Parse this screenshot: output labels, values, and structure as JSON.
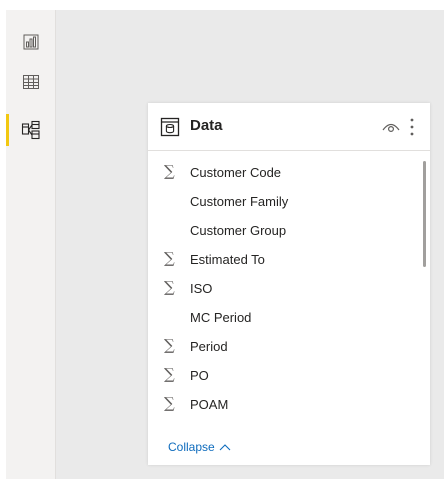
{
  "left_rail": {
    "items": [
      {
        "name": "report-view",
        "icon": "bar-chart-icon",
        "active": false
      },
      {
        "name": "table-view",
        "icon": "table-grid-icon",
        "active": false
      },
      {
        "name": "model-view",
        "icon": "model-diagram-icon",
        "active": true
      }
    ],
    "active_accent": "#f2c811"
  },
  "panel": {
    "title": "Data",
    "icons": [
      "database-icon",
      "eye-icon",
      "more-options-icon"
    ],
    "fields": [
      {
        "label": "Customer Code",
        "summarized": true,
        "symbol": "∑"
      },
      {
        "label": "Customer Family",
        "summarized": false,
        "symbol": ""
      },
      {
        "label": "Customer Group",
        "summarized": false,
        "symbol": ""
      },
      {
        "label": "Estimated To",
        "summarized": true,
        "symbol": "∑"
      },
      {
        "label": "ISO",
        "summarized": true,
        "symbol": "∑"
      },
      {
        "label": "MC Period",
        "summarized": false,
        "symbol": ""
      },
      {
        "label": "Period",
        "summarized": true,
        "symbol": "∑"
      },
      {
        "label": "PO",
        "summarized": true,
        "symbol": "∑"
      },
      {
        "label": "POAM",
        "summarized": true,
        "symbol": "∑"
      }
    ],
    "collapse_label": "Collapse",
    "link_color": "#0f6cbd"
  }
}
